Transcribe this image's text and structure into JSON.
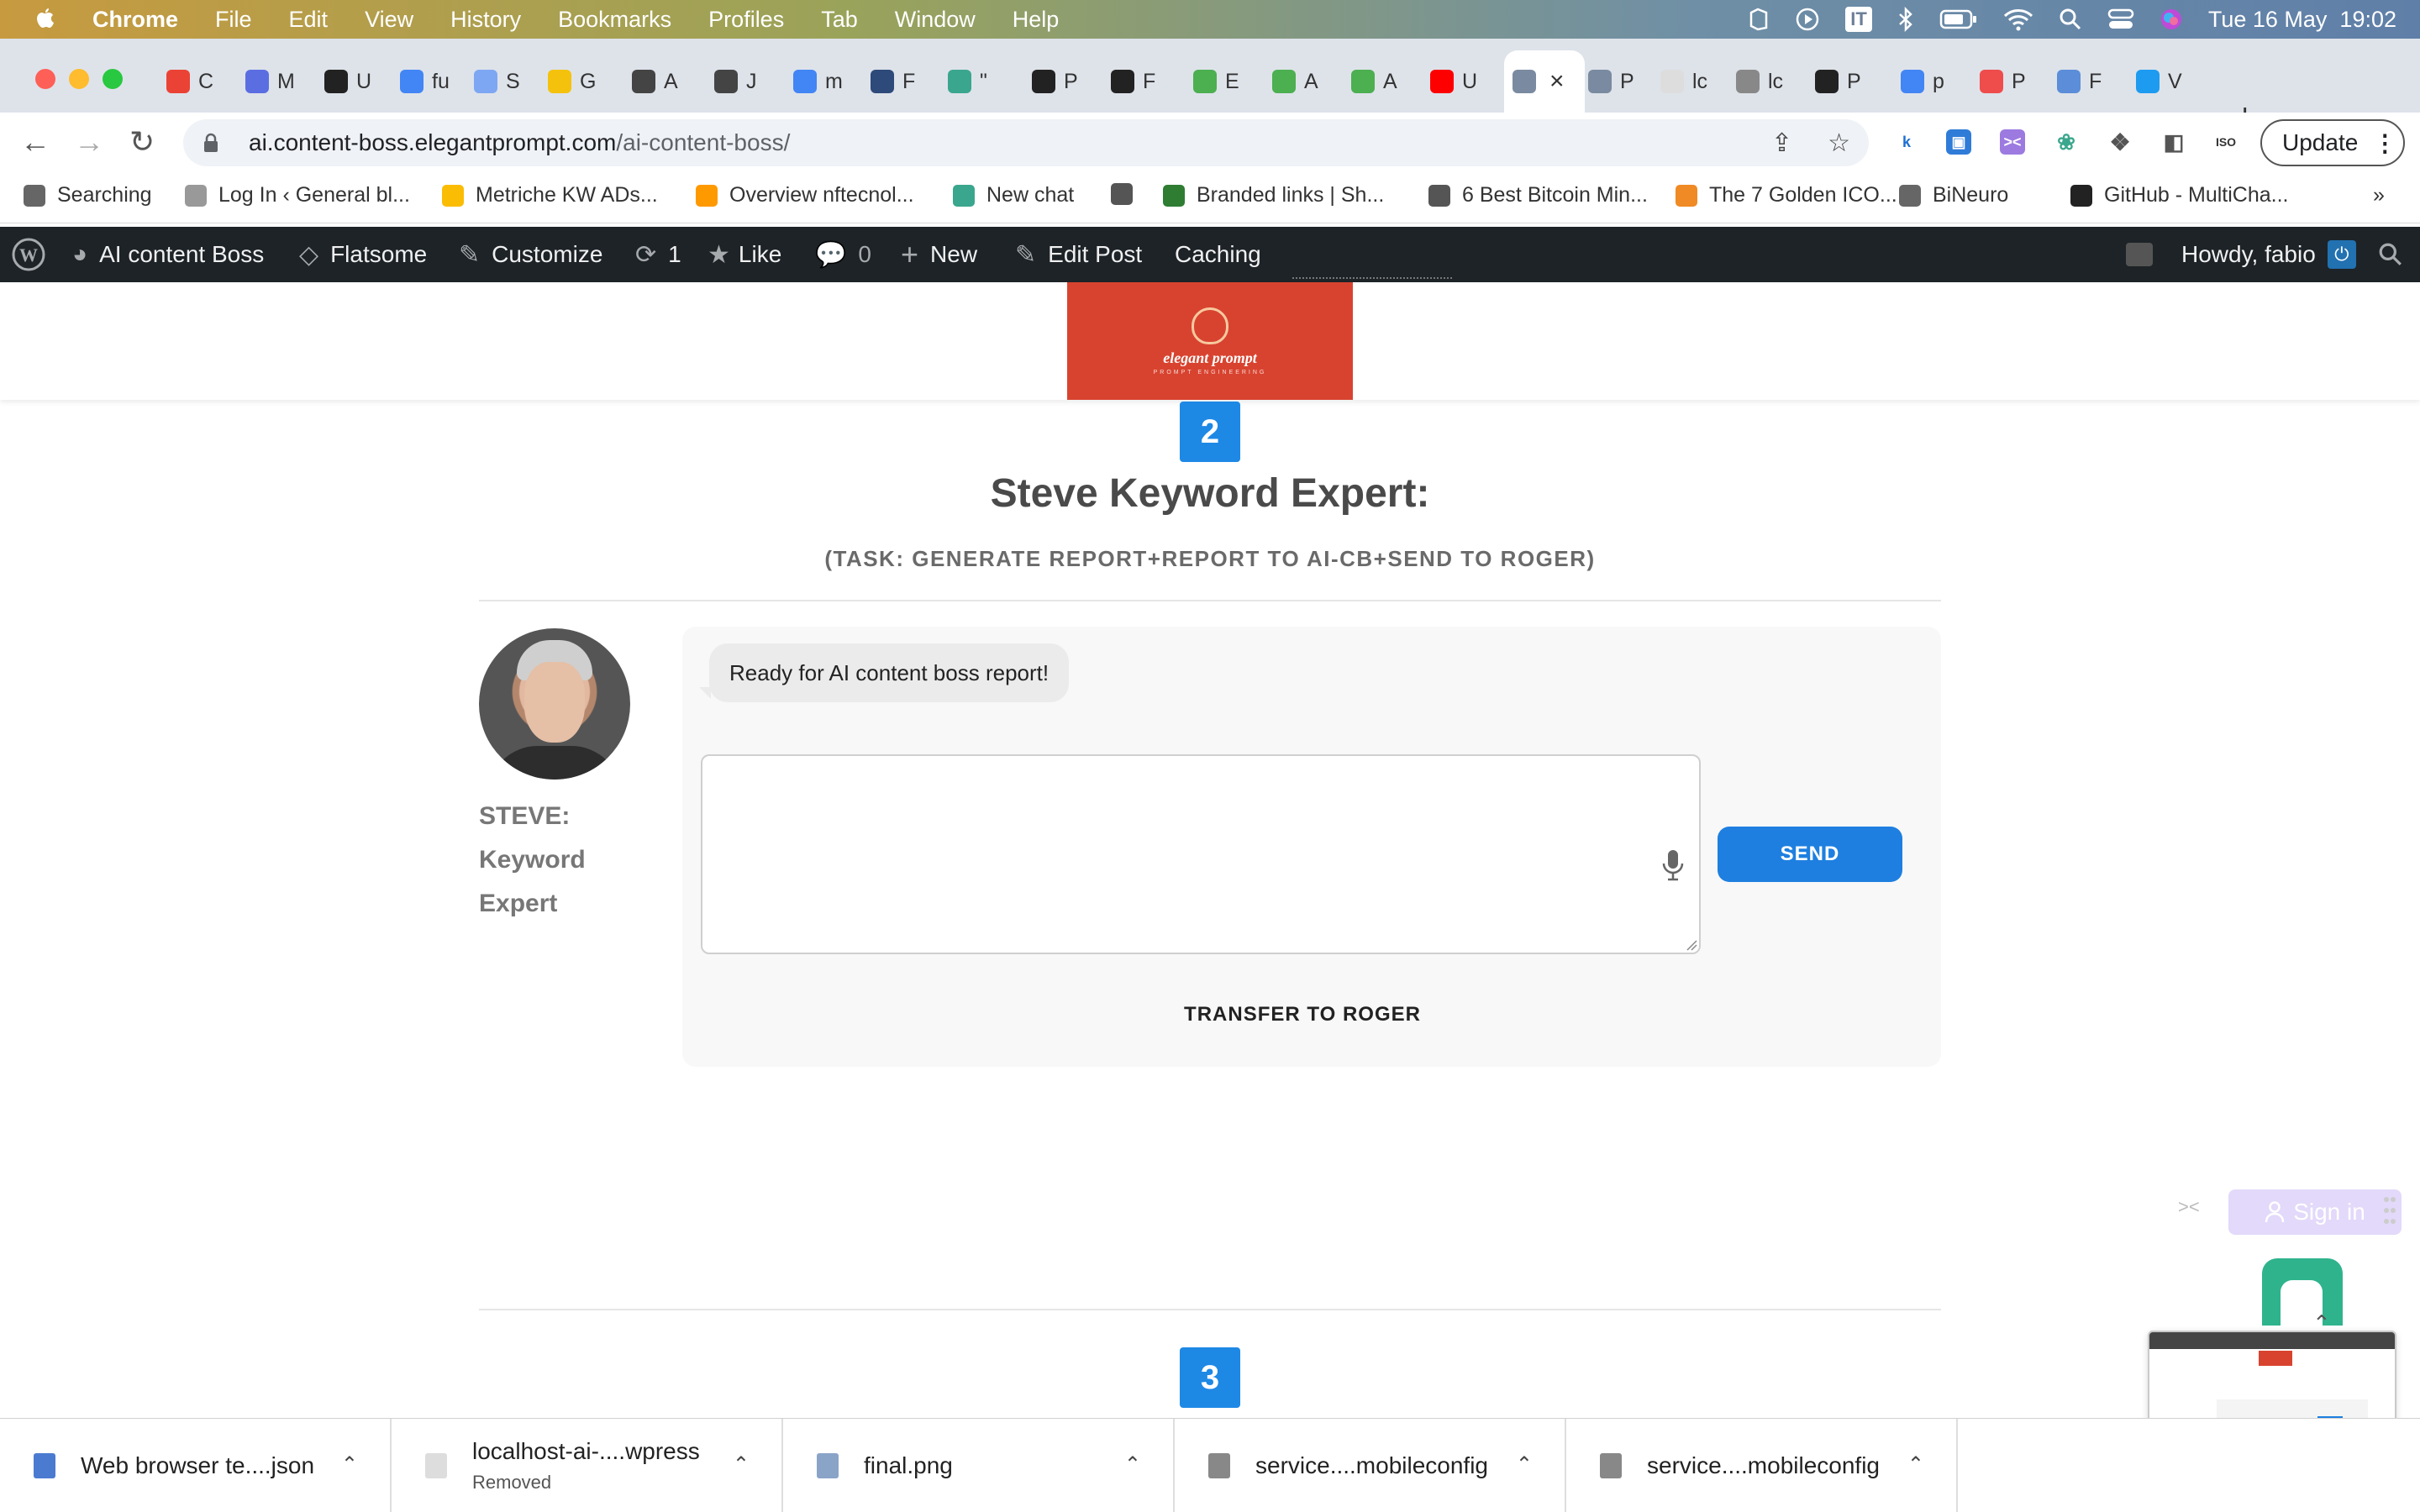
{
  "menubar": {
    "items": [
      "Chrome",
      "File",
      "Edit",
      "View",
      "History",
      "Bookmarks",
      "Profiles",
      "Tab",
      "Window",
      "Help"
    ],
    "it_badge": "IT",
    "datetime": "Tue 16 May  19:02"
  },
  "tabs": [
    {
      "label": "C",
      "icon": "gmail-icon",
      "color": "#ea4335"
    },
    {
      "label": "M",
      "icon": "app-icon",
      "color": "#5b6ee1"
    },
    {
      "label": "U",
      "icon": "openai-icon",
      "color": "#222222"
    },
    {
      "label": "fu",
      "icon": "google-icon",
      "color": "#4285f4"
    },
    {
      "label": "S",
      "icon": "ai-icon",
      "color": "#7da7f2"
    },
    {
      "label": "G",
      "icon": "bolt-icon",
      "color": "#f4c20d"
    },
    {
      "label": "A",
      "icon": "avatar-icon",
      "color": "#444444"
    },
    {
      "label": "J",
      "icon": "avatar-icon",
      "color": "#444444"
    },
    {
      "label": "m",
      "icon": "google-icon",
      "color": "#4285f4"
    },
    {
      "label": "F",
      "icon": "site-icon",
      "color": "#2d4a7a"
    },
    {
      "label": "\"",
      "icon": "openai-icon",
      "color": "#3aa68d"
    },
    {
      "label": "P",
      "icon": "github-icon",
      "color": "#222222"
    },
    {
      "label": "F",
      "icon": "github-icon",
      "color": "#222222"
    },
    {
      "label": "E",
      "icon": "map-icon",
      "color": "#4caf50"
    },
    {
      "label": "A",
      "icon": "map-icon",
      "color": "#4caf50"
    },
    {
      "label": "A",
      "icon": "map-icon",
      "color": "#4caf50"
    },
    {
      "label": "U",
      "icon": "youtube-icon",
      "color": "#ff0000"
    },
    {
      "label": "",
      "icon": "avatar-icon",
      "color": "#7a8aa0",
      "active": true
    },
    {
      "label": "P",
      "icon": "avatar-icon",
      "color": "#7a8aa0"
    },
    {
      "label": "lc",
      "icon": "page-icon",
      "color": "#dddddd"
    },
    {
      "label": "lc",
      "icon": "globe-icon",
      "color": "#888888"
    },
    {
      "label": "P",
      "icon": "openai-icon",
      "color": "#222222"
    },
    {
      "label": "p",
      "icon": "google-icon",
      "color": "#4285f4"
    },
    {
      "label": "P",
      "icon": "pinterest-icon",
      "color": "#ef4c4c"
    },
    {
      "label": "F",
      "icon": "doc-icon",
      "color": "#5b8dd9"
    },
    {
      "label": "V",
      "icon": "twitter-icon",
      "color": "#1d9bf0"
    }
  ],
  "address": {
    "host": "ai.content-boss.elegantprompt.com",
    "path": "/ai-content-boss/"
  },
  "toolbar": {
    "update_label": "Update"
  },
  "bookmarks": [
    {
      "label": "Searching",
      "color": "#666666"
    },
    {
      "label": "Log In ‹ General bl...",
      "color": "#999999"
    },
    {
      "label": "Metriche KW ADs...",
      "color": "#fbbc04"
    },
    {
      "label": "Overview nftecnol...",
      "color": "#ff9900"
    },
    {
      "label": "New chat",
      "color": "#3aa68d"
    },
    {
      "label": "",
      "color": "#555555"
    },
    {
      "label": "Branded links | Sh...",
      "color": "#2e7d32"
    },
    {
      "label": "6 Best Bitcoin Min...",
      "color": "#555555"
    },
    {
      "label": "The 7 Golden ICO...",
      "color": "#f08a24"
    },
    {
      "label": "BiNeuro",
      "color": "#666666"
    },
    {
      "label": "GitHub - MultiCha...",
      "color": "#222222"
    }
  ],
  "wpbar": {
    "site": "AI content Boss",
    "theme": "Flatsome",
    "customize": "Customize",
    "updates": "1",
    "like": "Like",
    "comments": "0",
    "new": "New",
    "edit": "Edit Post",
    "caching": "Caching",
    "howdy": "Howdy, fabio"
  },
  "logo": {
    "text": "elegant prompt",
    "sub": "PROMPT ENGINEERING"
  },
  "step_current": "2",
  "step_next": "3",
  "agent": {
    "title": "Steve Keyword Expert:",
    "task": "(TASK: GENERATE REPORT+REPORT TO AI-CB+SEND TO ROGER)",
    "name_line1": "STEVE:",
    "name_line2": "Keyword",
    "name_line3": "Expert",
    "message": "Ready for AI content boss report!",
    "input_value": "",
    "send_label": "SEND",
    "transfer_label": "TRANSFER TO ROGER"
  },
  "widgets": {
    "signin_label": "Sign in"
  },
  "downloads": [
    {
      "name": "Web browser te....json",
      "sub": "",
      "color": "#4a7bd0"
    },
    {
      "name": "localhost-ai-....wpress",
      "sub": "Removed",
      "color": "#dddddd"
    },
    {
      "name": "final.png",
      "sub": "",
      "color": "#8aa4c8"
    },
    {
      "name": "service....mobileconfig",
      "sub": "",
      "color": "#888888"
    },
    {
      "name": "service....mobileconfig",
      "sub": "",
      "color": "#888888"
    }
  ],
  "colors": {
    "accent": "#1e88e5",
    "logo_bg": "#d8432f",
    "wpbar_bg": "#1d2327"
  }
}
